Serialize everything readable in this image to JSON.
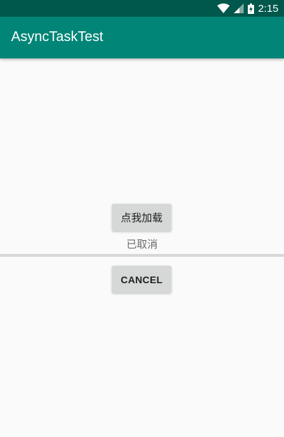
{
  "status_bar": {
    "time": "2:15",
    "icons": [
      "wifi-icon",
      "signal-icon",
      "battery-charging-icon"
    ]
  },
  "app_bar": {
    "title": "AsyncTaskTest"
  },
  "main": {
    "load_button": "点我加载",
    "status_text": "已取消",
    "progress": 0,
    "cancel_button": "CANCEL"
  },
  "colors": {
    "primary": "#008577",
    "primary_dark": "#00574b",
    "button": "#d6d7d7"
  }
}
